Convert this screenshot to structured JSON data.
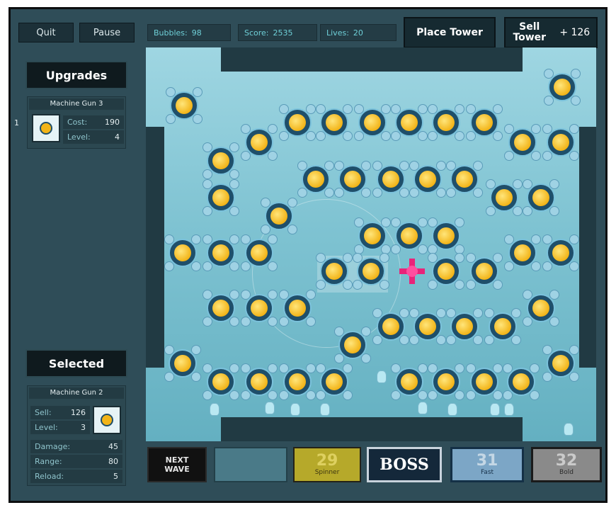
{
  "toolbar": {
    "quit_label": "Quit",
    "pause_label": "Pause",
    "bubbles_label": "Bubbles:",
    "bubbles_value": "98",
    "score_label": "Score:",
    "score_value": "2535",
    "lives_label": "Lives:",
    "lives_value": "20",
    "place_tower_label": "Place Tower",
    "sell_tower_label": "Sell Tower",
    "sell_value": "+ 126"
  },
  "upgrades": {
    "title": "Upgrades",
    "item_name": "Machine Gun 3",
    "index": "1",
    "cost_label": "Cost:",
    "cost_value": "190",
    "level_label": "Level:",
    "level_value": "4"
  },
  "selected": {
    "title": "Selected",
    "item_name": "Machine Gun 2",
    "sell_label": "Sell:",
    "sell_value": "126",
    "level_label": "Level:",
    "level_value": "3",
    "damage_label": "Damage:",
    "damage_value": "45",
    "range_label": "Range:",
    "range_value": "80",
    "reload_label": "Reload:",
    "reload_value": "5"
  },
  "waves": {
    "next_wave_label": "NEXT WAVE",
    "wave_29_number": "29",
    "wave_29_type": "Spinner",
    "boss_label": "BOSS",
    "wave_31_number": "31",
    "wave_31_type": "Fast",
    "wave_32_number": "32",
    "wave_32_type": "Bold"
  },
  "colors": {
    "tower_core": "#f2b418",
    "field": "#8ccbd9",
    "panel": "#2f4d58"
  }
}
